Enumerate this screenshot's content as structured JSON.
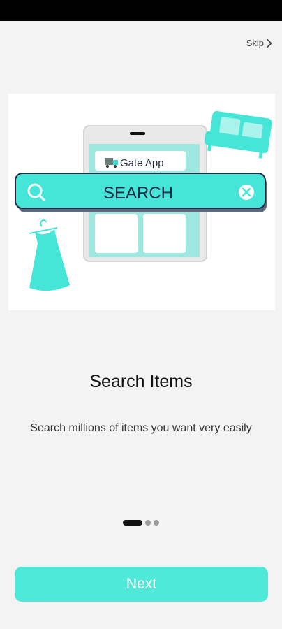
{
  "skip_label": "Skip",
  "illustration": {
    "app_name": "Gate App",
    "search_label": "SEARCH",
    "accent_color": "#45e6d8",
    "icons": [
      "truck-icon",
      "search-icon",
      "clear-icon",
      "sofa-icon",
      "dress-icon"
    ]
  },
  "title": "Search Items",
  "description": "Search millions of items you want very easily",
  "pager": {
    "page_count": 3,
    "current_page": 1
  },
  "next_label": "Next",
  "colors": {
    "primary": "#4ee9d9",
    "background": "#f3f3f3",
    "text": "#111111"
  }
}
